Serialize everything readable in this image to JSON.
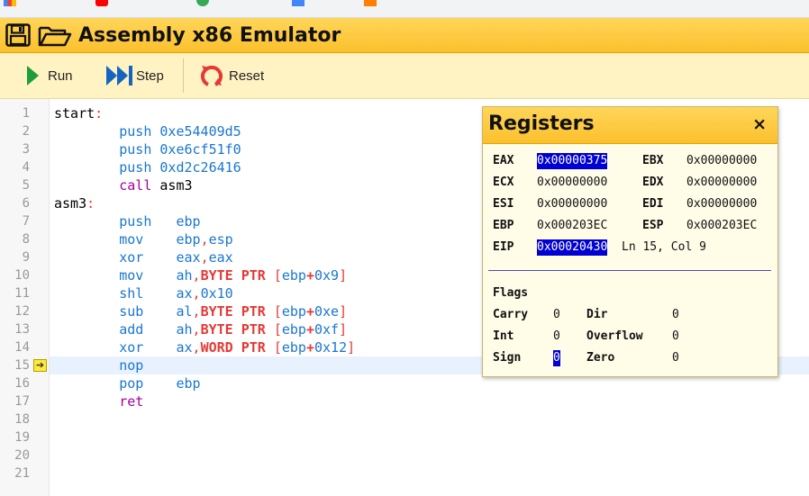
{
  "app": {
    "title": "Assembly x86 Emulator"
  },
  "toolbar": {
    "run_label": "Run",
    "step_label": "Step",
    "reset_label": "Reset"
  },
  "colors": {
    "header_yellow": "#fbc02d",
    "toolbar_bg": "#fff3c4",
    "current_line": "#e8f2fe",
    "highlight": "#0000d4",
    "run_green": "#1e9e3a",
    "step_blue": "#1565c0",
    "reset_red": "#e53935"
  },
  "editor": {
    "line_numbers": [
      "1",
      "2",
      "3",
      "4",
      "5",
      "6",
      "7",
      "8",
      "9",
      "10",
      "11",
      "12",
      "13",
      "14",
      "15",
      "16",
      "17",
      "18",
      "19",
      "20",
      "21"
    ],
    "current_line": "15"
  },
  "registers": {
    "title": "Registers",
    "close_label": "×",
    "eax": {
      "name": "EAX",
      "value": "0x00000375"
    },
    "ebx": {
      "name": "EBX",
      "value": "0x00000000"
    },
    "ecx": {
      "name": "ECX",
      "value": "0x00000000"
    },
    "edx": {
      "name": "EDX",
      "value": "0x00000000"
    },
    "esi": {
      "name": "ESI",
      "value": "0x00000000"
    },
    "edi": {
      "name": "EDI",
      "value": "0x00000000"
    },
    "ebp": {
      "name": "EBP",
      "value": "0x000203EC"
    },
    "esp": {
      "name": "ESP",
      "value": "0x000203EC"
    },
    "eip": {
      "name": "EIP",
      "value": "0x00020430"
    },
    "cursor_pos": "Ln 15, Col 9",
    "flags_title": "Flags",
    "carry": {
      "name": "Carry",
      "value": "0"
    },
    "dir": {
      "name": "Dir",
      "value": "0"
    },
    "int": {
      "name": "Int",
      "value": "0"
    },
    "overflow": {
      "name": "Overflow",
      "value": "0"
    },
    "sign": {
      "name": "Sign",
      "value": "0"
    },
    "zero": {
      "name": "Zero",
      "value": "0"
    }
  }
}
